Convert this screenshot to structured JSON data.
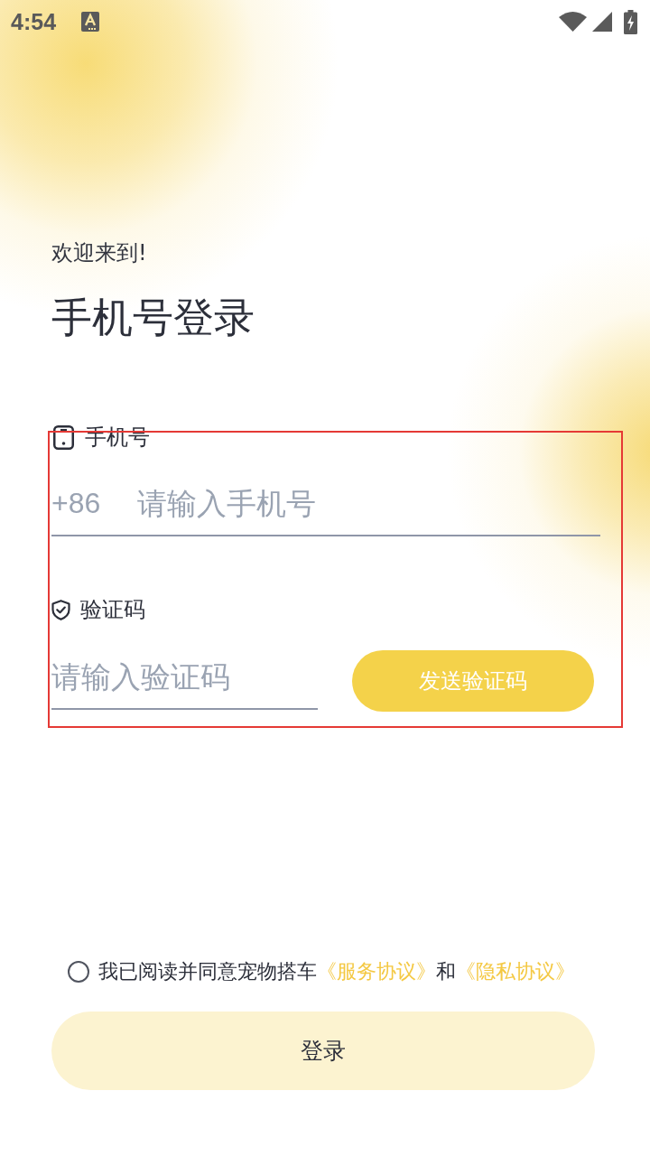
{
  "status_bar": {
    "time": "4:54"
  },
  "greeting": "欢迎来到!",
  "title": "手机号登录",
  "form": {
    "highlighted": true,
    "phone": {
      "label": "手机号",
      "prefix": "+86",
      "placeholder": "请输入手机号"
    },
    "code": {
      "label": "验证码",
      "placeholder": "请输入验证码",
      "send_button": "发送验证码"
    }
  },
  "agreement": {
    "checked": false,
    "parts": [
      {
        "kind": "text",
        "text": "我已阅读并同意宠物搭车"
      },
      {
        "kind": "link",
        "text": "《服务协议》"
      },
      {
        "kind": "text",
        "text": "和"
      },
      {
        "kind": "link",
        "text": "《隐私协议》"
      }
    ]
  },
  "login_button": {
    "label": "登录",
    "disabled": true
  }
}
